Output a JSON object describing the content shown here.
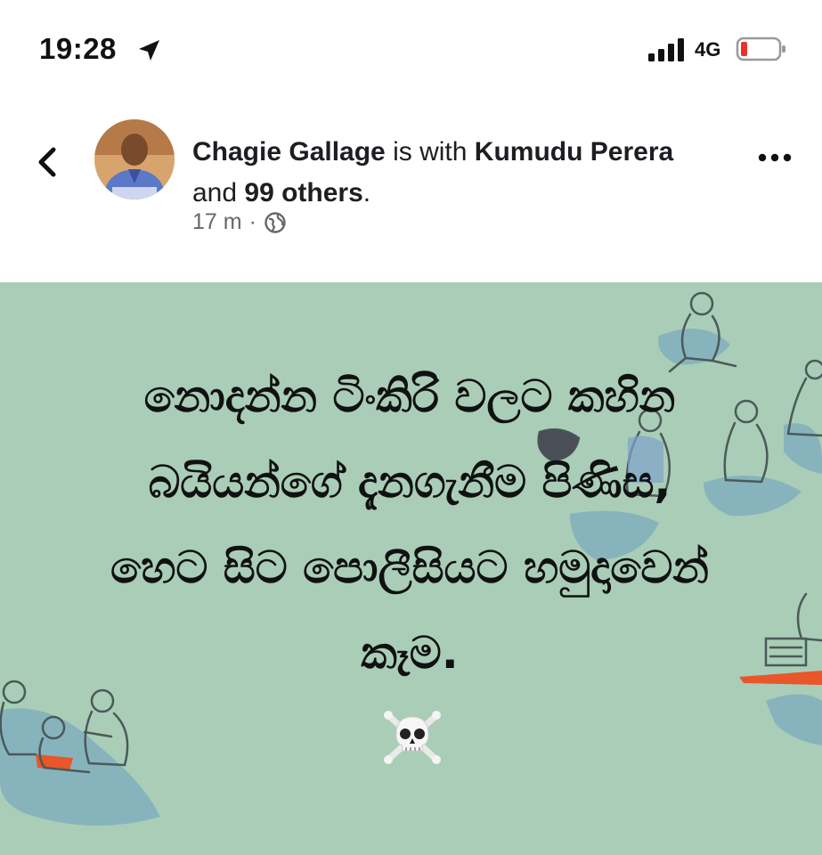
{
  "status_bar": {
    "time": "19:28",
    "network": "4G",
    "battery_color": "#e8332a"
  },
  "post": {
    "author": "Chagie Gallage",
    "is_with": "is with",
    "tagged_person": "Kumudu Perera",
    "and_text": "and",
    "others_count": "99 others",
    "period": ".",
    "time_ago": "17 m",
    "separator": "·",
    "privacy_icon": "globe-icon"
  },
  "image": {
    "background_color": "#a9cdb7",
    "text_lines": [
      "නොදන්න ටිංකිරි වලට කහින",
      "බයියන්ගේ දැනගැනීම පිණිස,",
      "හෙට සිට පොලීසියට හමුදාවෙන්",
      "කෑම."
    ],
    "emoji": "☠️"
  }
}
